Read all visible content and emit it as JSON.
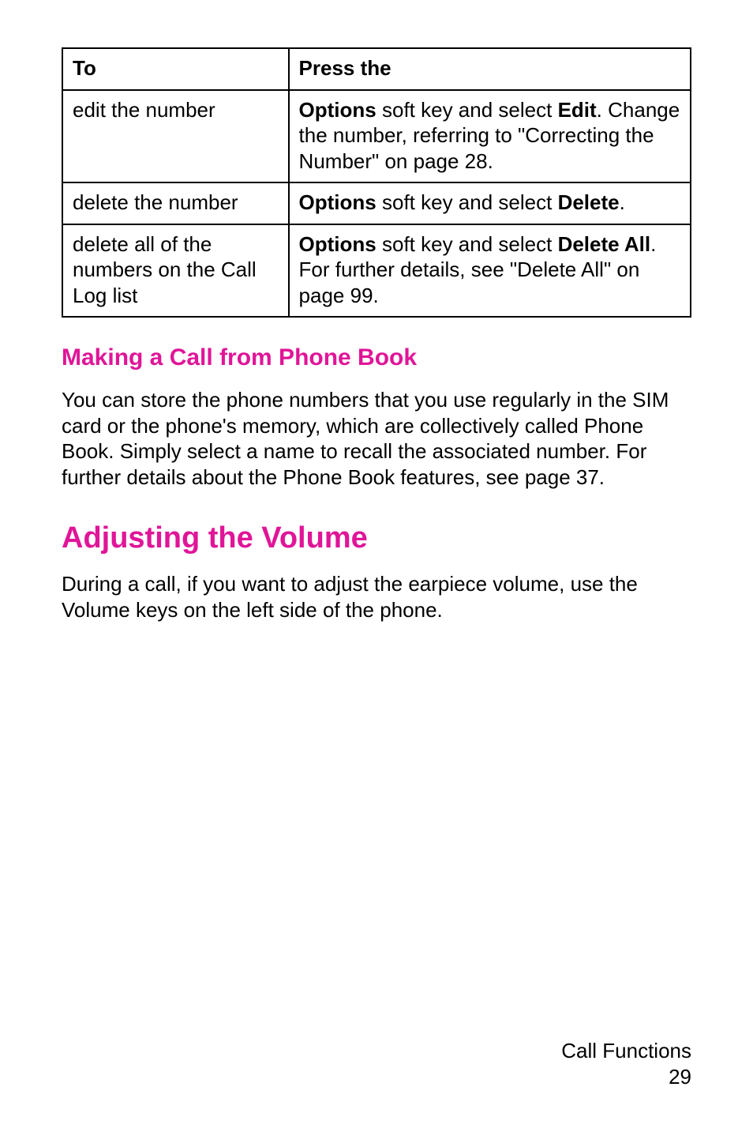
{
  "table": {
    "header": {
      "col1": "To",
      "col2": "Press the"
    },
    "rows": [
      {
        "to": "edit the number",
        "press_parts": {
          "p1": "Options",
          "p2": " soft key and select ",
          "p3": "Edit",
          "p4": ". Change the number, referring to \"Correcting the Number\" on page 28."
        }
      },
      {
        "to": "delete the number",
        "press_parts": {
          "p1": "Options",
          "p2": " soft key and select ",
          "p3": "Delete",
          "p4": "."
        }
      },
      {
        "to": "delete all of the numbers on the Call Log list",
        "press_parts": {
          "p1": "Options",
          "p2": " soft key and select ",
          "p3": "Delete All",
          "p4": ". For further details, see \"Delete All\" on page 99."
        }
      }
    ]
  },
  "section1": {
    "heading": "Making a Call from Phone Book",
    "body": "You can store the phone numbers that you use regularly in the SIM card or the phone's memory, which are collectively called Phone Book. Simply select a name to recall the associated number. For further details about the Phone Book features, see page 37."
  },
  "section2": {
    "heading": "Adjusting the Volume",
    "body": "During a call, if you want to adjust the earpiece volume, use the Volume keys on the left side of the phone."
  },
  "footer": {
    "chapter": "Call Functions",
    "page": "29"
  }
}
